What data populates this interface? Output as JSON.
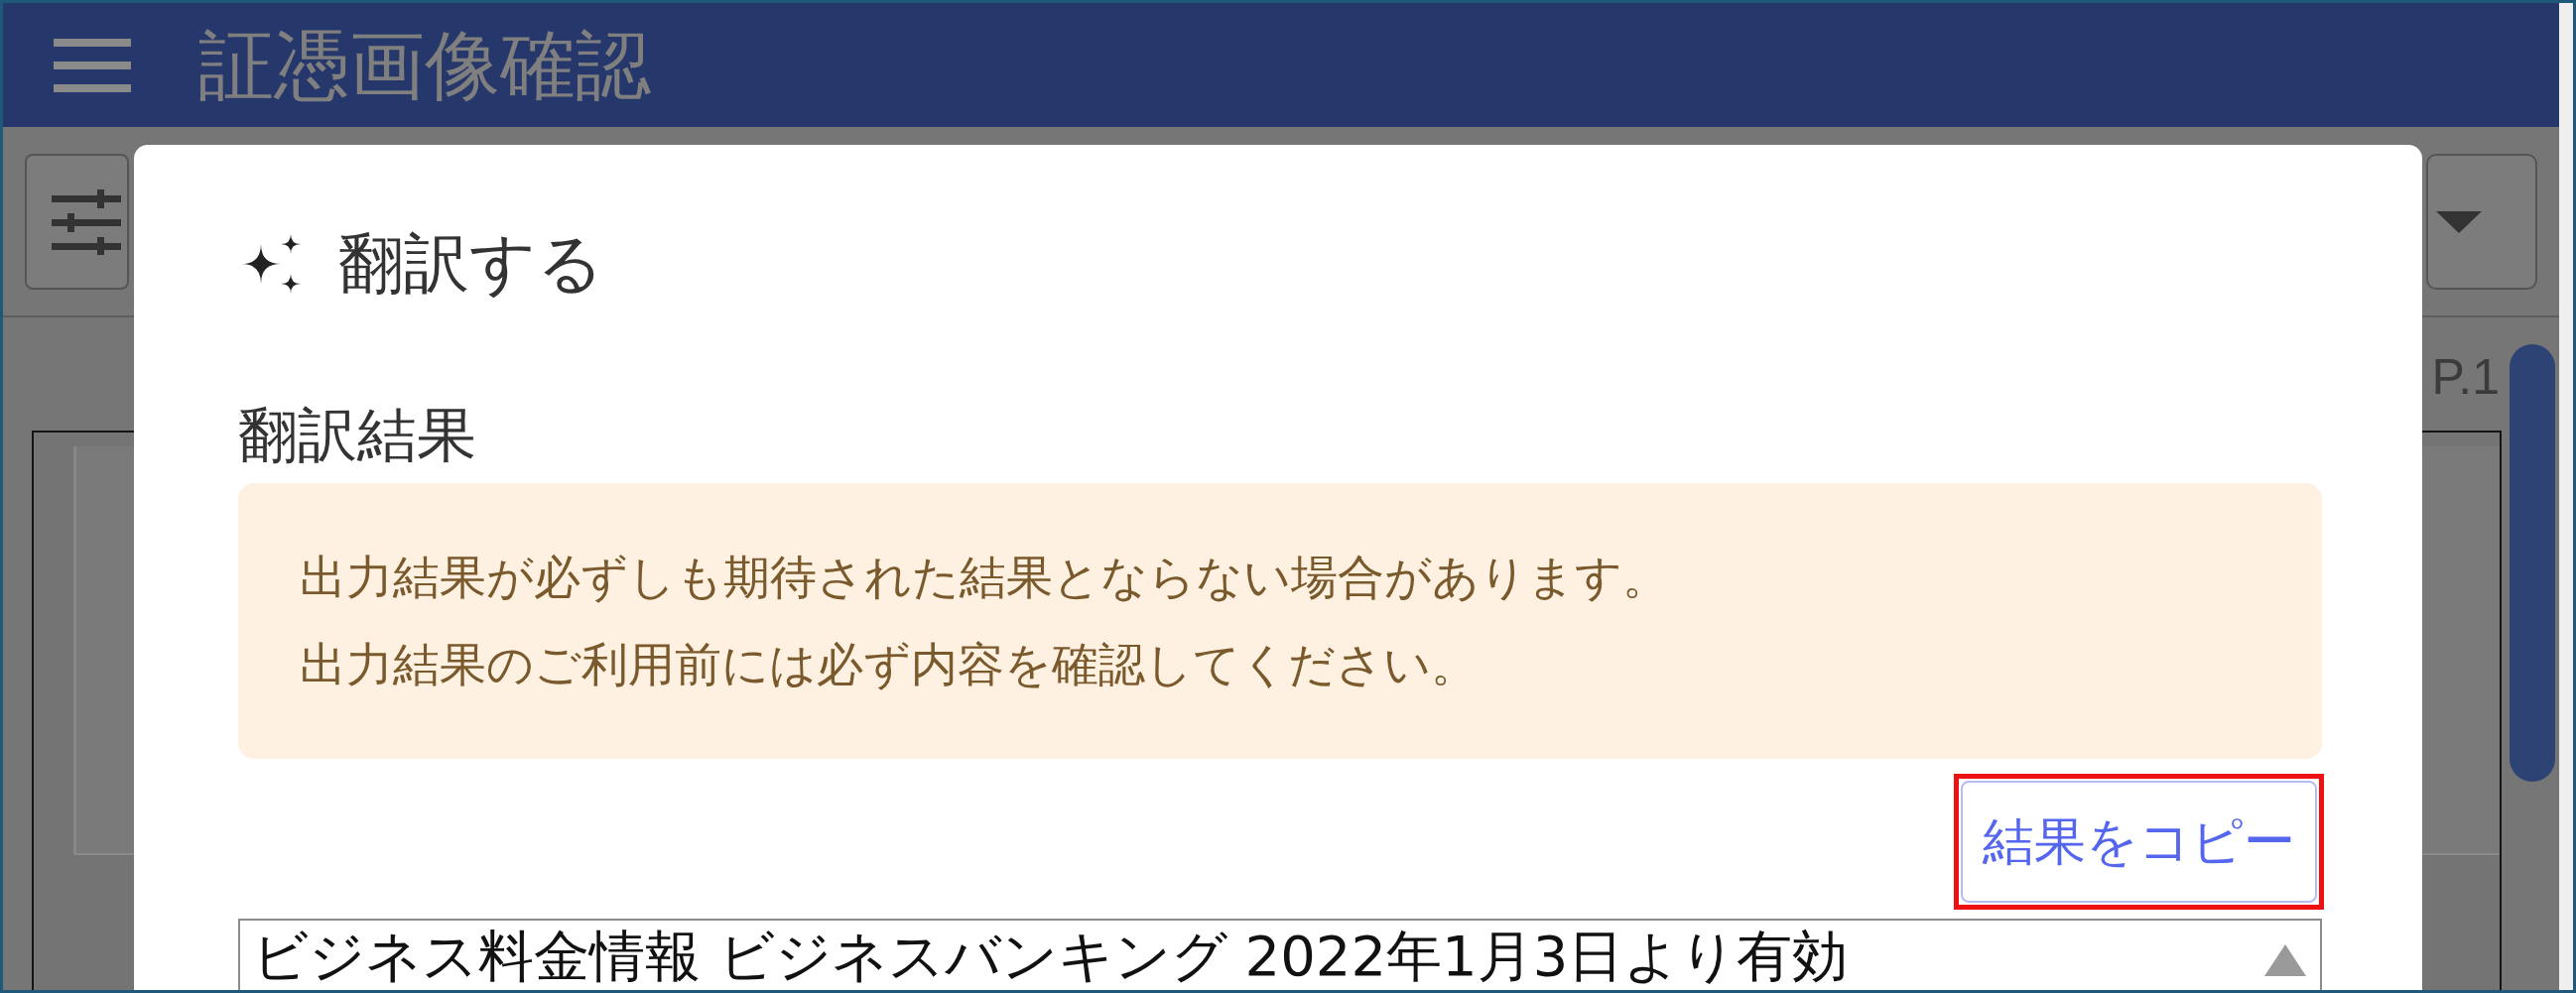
{
  "header": {
    "title": "証憑画像確認"
  },
  "viewer": {
    "page_label": "P.1"
  },
  "dialog": {
    "title": "翻訳する",
    "result_label": "翻訳結果",
    "notice_lines": [
      "出力結果が必ずしも期待された結果とならない場合があります。",
      "出力結果のご利用前には必ず内容を確認してください。"
    ],
    "copy_button": {
      "label": "結果をコピー",
      "highlighted": true
    },
    "result_text": "ビジネス料金情報 ビジネスバンキング 2022年1月3日より有効"
  }
}
